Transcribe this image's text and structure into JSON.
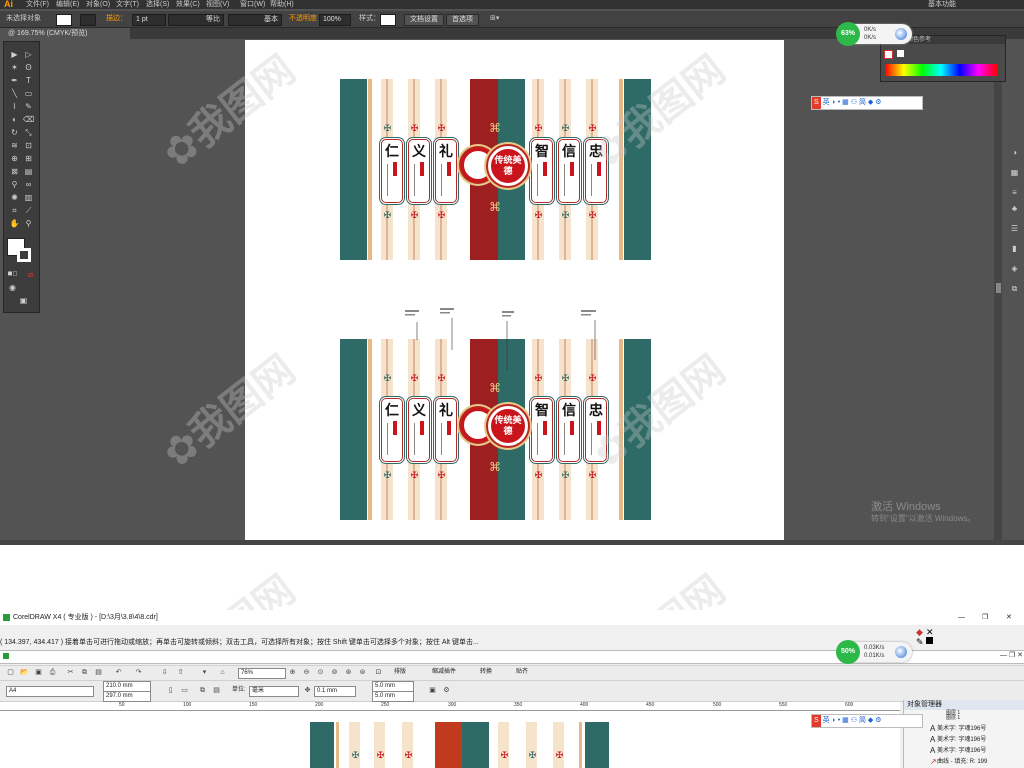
{
  "illustrator": {
    "menubar": {
      "logo": "Ai",
      "menus": [
        "文件(F)",
        "编辑(E)",
        "对象(O)",
        "文字(T)",
        "选择(S)",
        "效果(C)",
        "视图(V)",
        "窗口(W)",
        "帮助(H)"
      ],
      "workspace": "基本功能"
    },
    "control": {
      "selection": "未选择对象",
      "stroke_label": "描边：",
      "stroke_value": "1 pt",
      "profile_label": "等比",
      "brush_label": "基本",
      "opacity_label": "不透明度",
      "opacity_value": "100%",
      "style_label": "样式：",
      "doc_setup": "文档设置",
      "preferences": "首选项"
    },
    "doc_tab": "@ 169.75% (CMYK/预览)",
    "color_panel_title": "颜色参考",
    "colors": {
      "teal": "#2f6b66",
      "red": "#9e1f1f",
      "cream": "#f5e3cc",
      "gold": "#e8c989"
    },
    "design": {
      "chars": [
        "仁",
        "义",
        "礼",
        "智",
        "信",
        "忠"
      ],
      "medal": "传统美德"
    },
    "windows_activation": {
      "line1": "激活 Windows",
      "line2": "转到\"设置\"以激活 Windows。"
    }
  },
  "netmonitor": [
    {
      "percent": "63%",
      "up": "0K/s",
      "down": "0K/s"
    },
    {
      "percent": "50%",
      "up": "0.03K/s",
      "down": "0.01K/s"
    }
  ],
  "ime": {
    "badge": "S",
    "lang": "英",
    "mode": "简"
  },
  "coreldraw": {
    "title": "CorelDRAW X4 ( 专业版 ) - [D:\\3月\\3.8\\4\\8.cdr]",
    "status": "( 134.397, 434.417 )    接着单击可进行拖动或缩放；再单击可旋转或倾斜；双击工具，可选择所有对象；按住 Shift 键单击可选择多个对象；按住 Alt 键单击...",
    "zoom": "76%",
    "menu_labels": [
      "排版",
      "缩减插件",
      "转换",
      "贴齐"
    ],
    "page_size": "A4",
    "width": "210.0 mm",
    "height": "297.0 mm",
    "units_label": "单位:",
    "units": "毫米",
    "nudge": "0.1 mm",
    "dup_x": "5.0 mm",
    "dup_y": "5.0 mm",
    "ruler": [
      "50",
      "100",
      "150",
      "200",
      "250",
      "300",
      "350",
      "400",
      "450",
      "500",
      "550",
      "600"
    ],
    "object_manager": {
      "title": "对象管理器",
      "layers": [
        "图层 1",
        "图层 1"
      ],
      "rows": [
        "美术字:  字魂196号",
        "美术字:  字魂196号",
        "美术字:  字魂196号",
        "曲线 - 填充: R: 199"
      ]
    }
  }
}
